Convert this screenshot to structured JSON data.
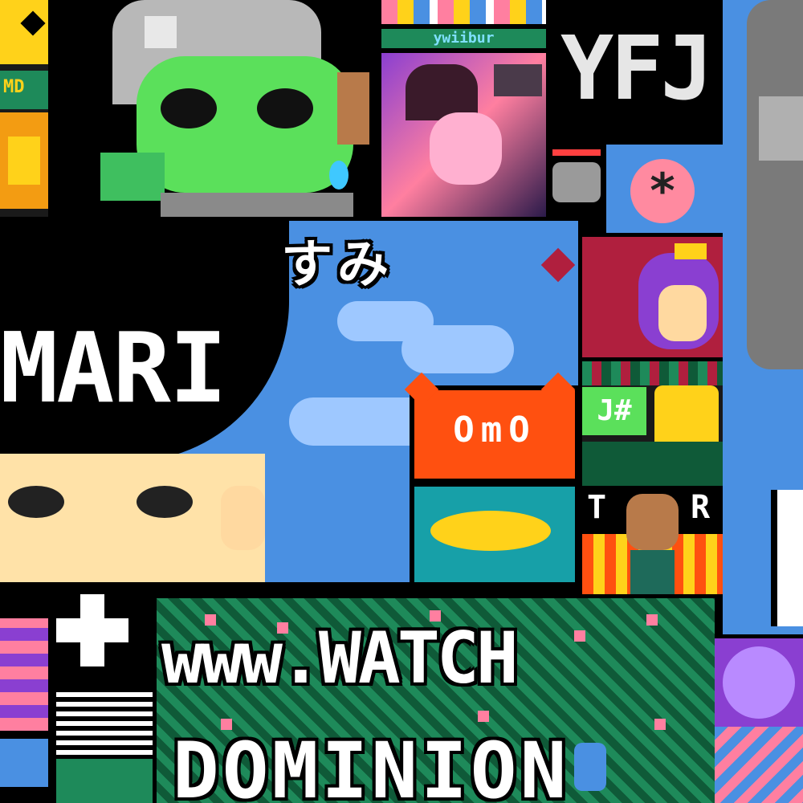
{
  "canvas": {
    "background": "#000000",
    "palette": {
      "sky_blue": "#4a90e2",
      "light_sky": "#9ec8ff",
      "cloud": "#d8e6ff",
      "grass_green": "#1e8a5a",
      "dark_green": "#0f5a38",
      "pink_flower": "#ff7fa0",
      "orange_cat": "#ff5010",
      "teal": "#17a0a8",
      "yellow": "#ffd21a",
      "skin": "#ffe2a8",
      "lime_green": "#5be05b",
      "gray_hair": "#b8b8b8",
      "purple": "#8a3fd1",
      "red_wine": "#b01f3e"
    }
  },
  "art": {
    "top_center_tag": "ywiibur",
    "mari_banner": {
      "title": "MARI",
      "kana": "すみ",
      "cat_face": "OmO"
    },
    "right_tile_text": "J#",
    "tr_letters": [
      "T",
      "R"
    ],
    "watch_banner": {
      "line1": "www.WATCH",
      "line2": "DOMINION"
    },
    "top_right_letters": "YFJ",
    "asterisk_badge": "*"
  }
}
